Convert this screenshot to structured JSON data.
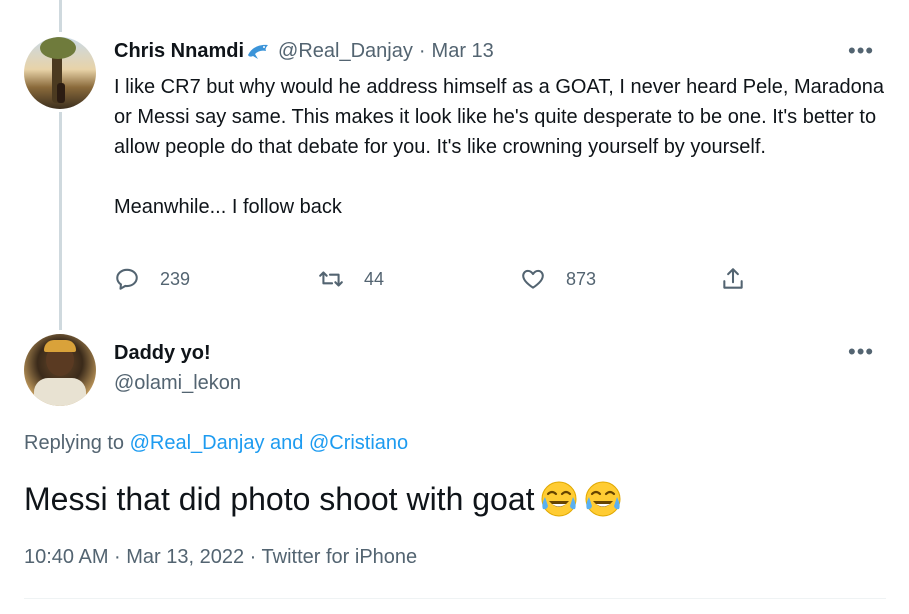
{
  "parent_tweet": {
    "display_name": "Chris Nnamdi",
    "handle": "@Real_Danjay",
    "separator": "·",
    "date": "Mar 13",
    "text_p1": "I like CR7 but why would he address himself as a GOAT, I never heard Pele, Maradona or Messi say same. This makes it look like he's quite desperate to be one. It's better to allow people do that debate for you. It's like crowning yourself by yourself.",
    "text_p2": "Meanwhile... I follow back",
    "replies": "239",
    "retweets": "44",
    "likes": "873",
    "more_label": "•••"
  },
  "reply_tweet": {
    "display_name": "Daddy yo!",
    "handle": "@olami_lekon",
    "more_label": "•••",
    "replying_prefix": "Replying to",
    "replying_user1": "@Real_Danjay",
    "replying_and": "and",
    "replying_user2": "@Cristiano",
    "text": "Messi that did photo shoot with goat",
    "timestamp": "10:40 AM · Mar 13, 2022 · Twitter for iPhone"
  },
  "icons": {
    "name_emoji": "dolphin-icon",
    "reply": "reply-icon",
    "retweet": "retweet-icon",
    "like": "heart-icon",
    "share": "share-icon",
    "text_emoji": "tears-of-joy-emoji"
  },
  "colors": {
    "text": "#0f1419",
    "secondary": "#536471",
    "link": "#1d9bf0",
    "thread_line": "#cfd9de"
  }
}
